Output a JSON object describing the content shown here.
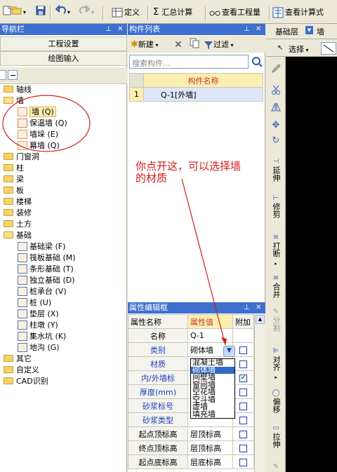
{
  "toolbar": {
    "define": "定义",
    "sum_calc": "汇总计算",
    "view_quantity": "查看工程量",
    "view_formula": "查看计算式",
    "floor_label": "基础层",
    "component_select": "墙",
    "select_label": "选择"
  },
  "left_nav": {
    "title": "导航栏",
    "project_settings": "工程设置",
    "draw_input": "绘图输入",
    "tree": [
      {
        "label": "轴线",
        "indent": 0,
        "type": "folder"
      },
      {
        "label": "墙",
        "indent": 0,
        "type": "folder-open"
      },
      {
        "label": "墙 (Q)",
        "indent": 1,
        "type": "wall"
      },
      {
        "label": "保温墙 (Q)",
        "indent": 1,
        "type": "insul"
      },
      {
        "label": "墙垛 (E)",
        "indent": 1,
        "type": "pier"
      },
      {
        "label": "幕墙 (Q)",
        "indent": 1,
        "type": "curtain"
      },
      {
        "label": "门窗洞",
        "indent": 0,
        "type": "folder"
      },
      {
        "label": "柱",
        "indent": 0,
        "type": "folder"
      },
      {
        "label": "梁",
        "indent": 0,
        "type": "folder"
      },
      {
        "label": "板",
        "indent": 0,
        "type": "folder"
      },
      {
        "label": "楼梯",
        "indent": 0,
        "type": "folder"
      },
      {
        "label": "装修",
        "indent": 0,
        "type": "folder"
      },
      {
        "label": "土方",
        "indent": 0,
        "type": "folder"
      },
      {
        "label": "基础",
        "indent": 0,
        "type": "folder-open"
      },
      {
        "label": "基础梁 (F)",
        "indent": 1,
        "type": "beam"
      },
      {
        "label": "筏板基础 (M)",
        "indent": 1,
        "type": "raft"
      },
      {
        "label": "条形基础 (T)",
        "indent": 1,
        "type": "strip"
      },
      {
        "label": "独立基础 (D)",
        "indent": 1,
        "type": "isolated"
      },
      {
        "label": "桩承台 (V)",
        "indent": 1,
        "type": "cap"
      },
      {
        "label": "桩 (U)",
        "indent": 1,
        "type": "pile"
      },
      {
        "label": "垫层 (X)",
        "indent": 1,
        "type": "cushion"
      },
      {
        "label": "柱墩 (Y)",
        "indent": 1,
        "type": "pier2"
      },
      {
        "label": "集水坑 (K)",
        "indent": 1,
        "type": "pit"
      },
      {
        "label": "地沟 (G)",
        "indent": 1,
        "type": "trench"
      },
      {
        "label": "其它",
        "indent": 0,
        "type": "folder"
      },
      {
        "label": "自定义",
        "indent": 0,
        "type": "folder"
      },
      {
        "label": "CAD识别",
        "indent": 0,
        "type": "folder"
      }
    ]
  },
  "component_list": {
    "title": "构件列表",
    "new_label": "新建",
    "filter_label": "过滤",
    "search_placeholder": "搜索构件...",
    "col_name": "构件名称",
    "rows": [
      {
        "index": "1",
        "name": "Q-1[外墙]"
      }
    ]
  },
  "property_editor": {
    "title": "属性编辑框",
    "col_name": "属性名称",
    "col_value": "属性值",
    "col_extra": "附加",
    "rows": [
      {
        "name": "名称",
        "value": "Q-1",
        "checkbox": false,
        "blue": false
      },
      {
        "name": "类别",
        "value": "砌体墙",
        "checkbox": true,
        "checked": false,
        "blue": true
      },
      {
        "name": "材质",
        "value": "",
        "checkbox": true,
        "checked": false,
        "blue": true
      },
      {
        "name": "内/外墙标",
        "value": "",
        "checkbox": true,
        "checked": true,
        "blue": true
      },
      {
        "name": "厚度(mm)",
        "value": "",
        "checkbox": true,
        "checked": false,
        "blue": true
      },
      {
        "name": "砂浆标号",
        "value": "",
        "checkbox": true,
        "checked": false,
        "blue": true
      },
      {
        "name": "砂浆类型",
        "value": "",
        "checkbox": true,
        "checked": false,
        "blue": true
      },
      {
        "name": "起点顶标高",
        "value": "层顶标高",
        "checkbox": true,
        "checked": false,
        "blue": false
      },
      {
        "name": "终点顶标高",
        "value": "层顶标高",
        "checkbox": true,
        "checked": false,
        "blue": false
      },
      {
        "name": "起点底标高",
        "value": "层底标高",
        "checkbox": true,
        "checked": false,
        "blue": false
      }
    ],
    "dropdown_options": [
      "混凝土墙",
      "砌体墙",
      "间壁墙",
      "窗间墙",
      "空花墙",
      "空斗墙",
      "虚墙",
      "填充墙"
    ],
    "dropdown_selected_index": 1
  },
  "right_tools": {
    "extend": "延伸",
    "trim": "修剪",
    "break": "打断",
    "merge": "合并",
    "split": "分割",
    "align": "对齐",
    "offset": "偏移",
    "stretch": "拉伸"
  },
  "annotation": {
    "text_line1": "你点开这，可以选择墙",
    "text_line2": "的材质"
  },
  "colors": {
    "title_bar": "#3f6fcf",
    "annotation": "#d41c1c",
    "property_blue": "#1c3fb5",
    "header_bg": "#fbeeb0"
  }
}
